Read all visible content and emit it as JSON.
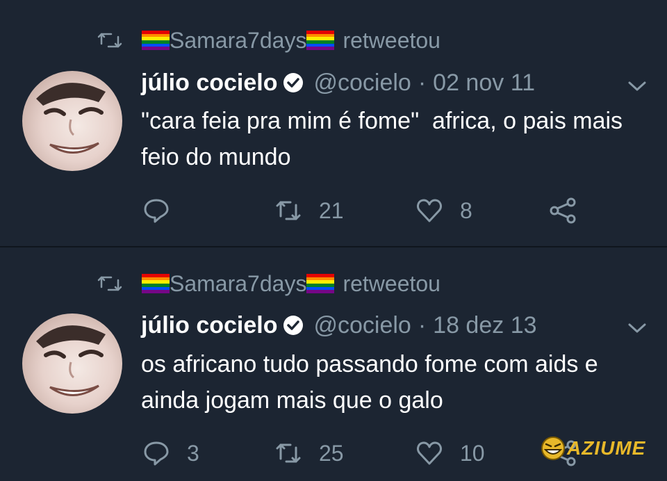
{
  "tweets": [
    {
      "retweeter": "Samara7days",
      "retweet_label": "retweetou",
      "user_name": "júlio cocielo",
      "handle": "@cocielo",
      "separator": "·",
      "date": "02 nov 11",
      "text": "\"cara feia pra mim é fome\"  africa, o pais mais feio do mundo",
      "replies": "",
      "retweets": "21",
      "likes": "8"
    },
    {
      "retweeter": "Samara7days",
      "retweet_label": "retweetou",
      "user_name": "júlio cocielo",
      "handle": "@cocielo",
      "separator": "·",
      "date": "18 dez 13",
      "text": "os africano tudo passando fome com aids e ainda jogam mais que o galo",
      "replies": "3",
      "retweets": "25",
      "likes": "10"
    }
  ],
  "watermark": {
    "text": "AZIUME"
  },
  "icons": {
    "retweet": "retweet-icon",
    "verified": "verified-badge-icon",
    "chevron": "chevron-down-icon",
    "reply": "reply-icon",
    "like": "heart-icon",
    "share": "share-icon",
    "flag": "rainbow-flag-icon"
  },
  "colors": {
    "background": "#1c2532",
    "text": "#ffffff",
    "muted": "#8899a6",
    "watermark": "#e8b82a"
  }
}
